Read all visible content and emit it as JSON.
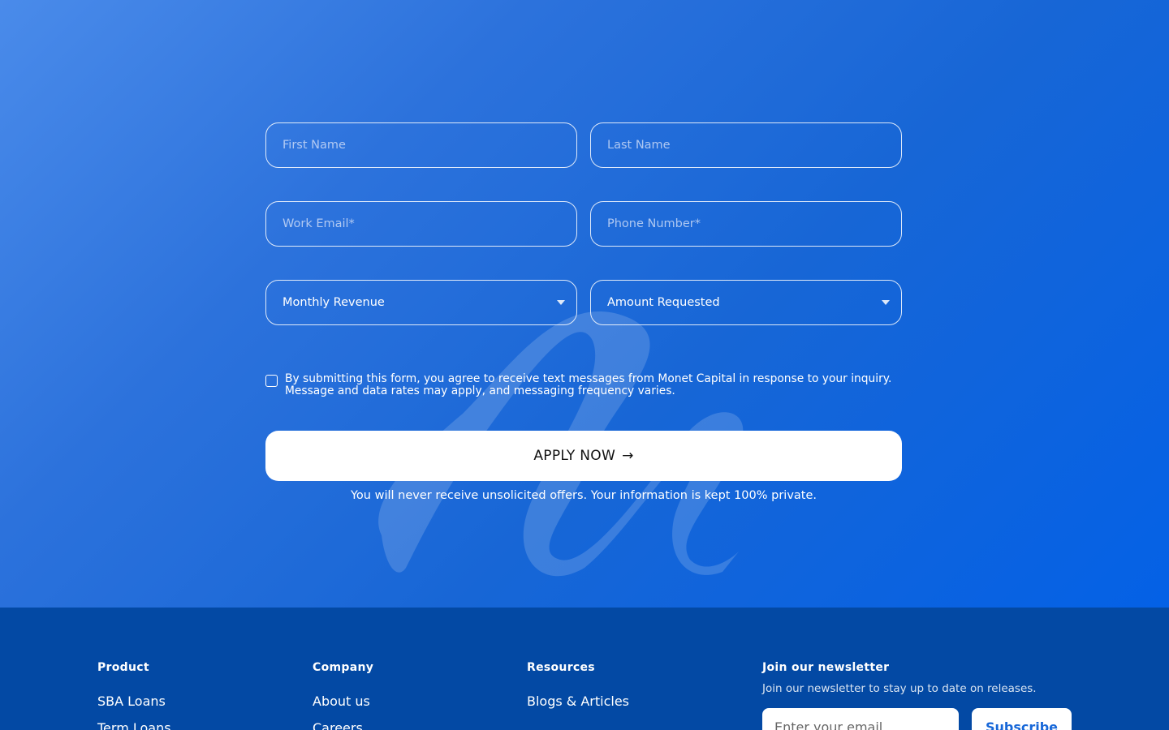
{
  "form": {
    "first_name_placeholder": "First Name",
    "last_name_placeholder": "Last Name",
    "work_email_placeholder": "Work Email*",
    "phone_placeholder": "Phone Number*",
    "monthly_revenue": "Monthly Revenue",
    "amount_requested": "Amount Requested",
    "consent_text": "By submitting this form, you agree to receive text messages from Monet Capital in response to your inquiry. Message and data rates may apply, and messaging frequency varies.",
    "consent_checked": false,
    "apply_label": "APPLY NOW",
    "privacy_note": "You will never receive unsolicited offers. Your information is kept 100% private."
  },
  "footer": {
    "product": {
      "title": "Product",
      "links": [
        "SBA Loans",
        "Term Loans"
      ]
    },
    "company": {
      "title": "Company",
      "links": [
        "About us",
        "Careers"
      ]
    },
    "resources": {
      "title": "Resources",
      "links": [
        "Blogs & Articles"
      ]
    },
    "newsletter": {
      "title": "Join our newsletter",
      "subtitle": "Join our newsletter to stay up to date on releases.",
      "email_placeholder": "Enter your email",
      "subscribe_label": "Subscribe"
    }
  },
  "colors": {
    "hero_gradient_start": "#4a8bea",
    "hero_gradient_end": "#0461e6",
    "footer_bg": "#0349a4",
    "subscribe_text": "#1767d8"
  }
}
